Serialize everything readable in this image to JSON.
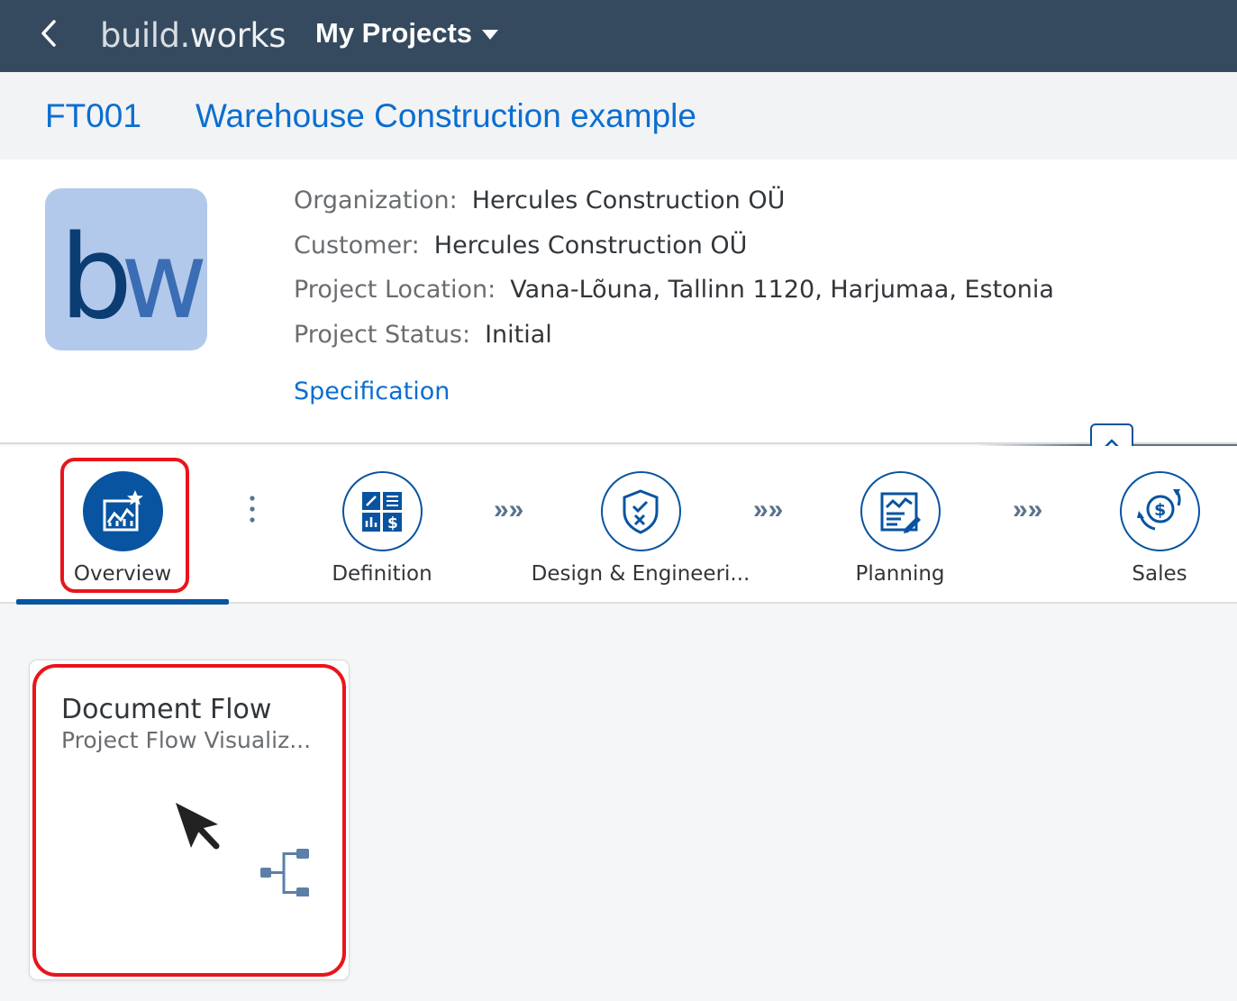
{
  "shell": {
    "brand_name": "build",
    "brand_dot": ".",
    "brand_suffix": "works",
    "app_title": "My Projects"
  },
  "project": {
    "id": "FT001",
    "name": "Warehouse Construction example",
    "logo_text": "bw",
    "attributes": [
      {
        "label": "Organization:",
        "value": "Hercules Construction OÜ"
      },
      {
        "label": "Customer:",
        "value": "Hercules Construction OÜ"
      },
      {
        "label": "Project Location:",
        "value": "Vana-Lõuna, Tallinn 1120, Harjumaa, Estonia"
      },
      {
        "label": "Project Status:",
        "value": "Initial"
      }
    ],
    "link": "Specification"
  },
  "nav": {
    "items": [
      {
        "label": "Overview",
        "icon": "overview-chart-icon",
        "active": true
      },
      {
        "label": "Definition",
        "icon": "definition-icon",
        "active": false
      },
      {
        "label": "Design & Engineeri...",
        "icon": "shield-check-icon",
        "active": false
      },
      {
        "label": "Planning",
        "icon": "planning-icon",
        "active": false
      },
      {
        "label": "Sales",
        "icon": "sales-icon",
        "active": false
      }
    ],
    "separator": "»»"
  },
  "tile": {
    "title": "Document Flow",
    "subtitle": "Project Flow Visualiz...",
    "icon": "flow-tree-icon"
  },
  "colors": {
    "shell_bg": "#354a5f",
    "accent": "#0a6ed1",
    "nav_blue": "#0854a0",
    "highlight": "#e8151b",
    "logo_bg": "#b3c9eb"
  }
}
